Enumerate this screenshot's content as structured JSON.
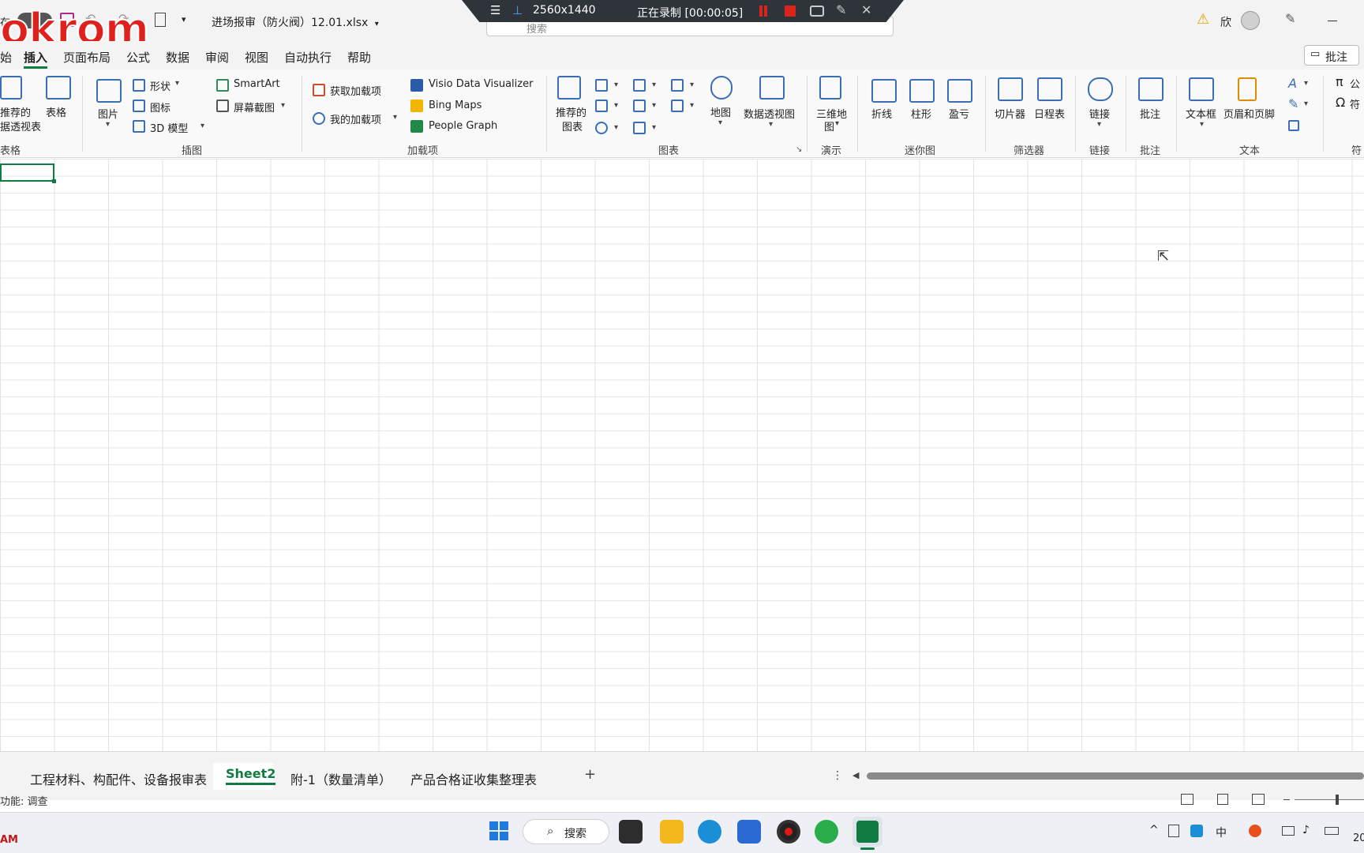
{
  "app": {
    "file_title": "进场报审（防火阀）12.01.xlsx",
    "qat_save_label": "存",
    "watermark": "okrom"
  },
  "recorder": {
    "resolution": "2560x1440",
    "status": "正在录制 [00:00:05]"
  },
  "search": {
    "placeholder": "搜索"
  },
  "titlebar_right": {
    "user_initial": "欣"
  },
  "menu_tabs": [
    "插入",
    "页面布局",
    "公式",
    "数据",
    "审阅",
    "视图",
    "自动执行",
    "帮助"
  ],
  "menu_partial_left": "始",
  "comment_button": "批注",
  "ribbon": {
    "table_group": {
      "pivot_label_1": "推荐的",
      "pivot_label_2": "据透视表",
      "table": "表格",
      "group": "表格"
    },
    "illustrations": {
      "picture": "图片",
      "shapes": "形状",
      "icons": "图标",
      "model3d": "3D 模型",
      "smartart": "SmartArt",
      "screenshot": "屏幕截图",
      "group": "插图"
    },
    "addins": {
      "get": "获取加载项",
      "mine": "我的加载项",
      "visio": "Visio Data Visualizer",
      "bing": "Bing Maps",
      "people": "People Graph",
      "group": "加载项"
    },
    "charts": {
      "recommended_1": "推荐的",
      "recommended_2": "图表",
      "map": "地图",
      "pivotchart": "数据透视图",
      "group": "图表"
    },
    "tours": {
      "map3d_1": "三维地",
      "map3d_2": "图",
      "group": "演示"
    },
    "sparklines": {
      "line": "折线",
      "column": "柱形",
      "winloss": "盈亏",
      "group": "迷你图"
    },
    "filters": {
      "slicer": "切片器",
      "timeline": "日程表",
      "group": "筛选器"
    },
    "links": {
      "link": "链接",
      "group": "链接"
    },
    "comments": {
      "comment": "批注",
      "group": "批注"
    },
    "text": {
      "textbox": "文本框",
      "headerfooter": "页眉和页脚",
      "group": "文本"
    },
    "symbols": {
      "equation": "公",
      "symbol": "符",
      "group": "符"
    }
  },
  "sheets": {
    "tabs": [
      "工程材料、构配件、设备报审表",
      "Sheet2",
      "附-1（数量清单）",
      "产品合格证收集整理表"
    ],
    "active_index": 1
  },
  "statusbar": {
    "accessibility": "功能: 调查"
  },
  "taskbar": {
    "search": "搜索",
    "ime": "中",
    "left_badge": "AM",
    "clock_partial": "20"
  },
  "colors": {
    "excel_green": "#107c41",
    "accent_blue": "#3b6fb5",
    "record_red": "#d9241c"
  }
}
